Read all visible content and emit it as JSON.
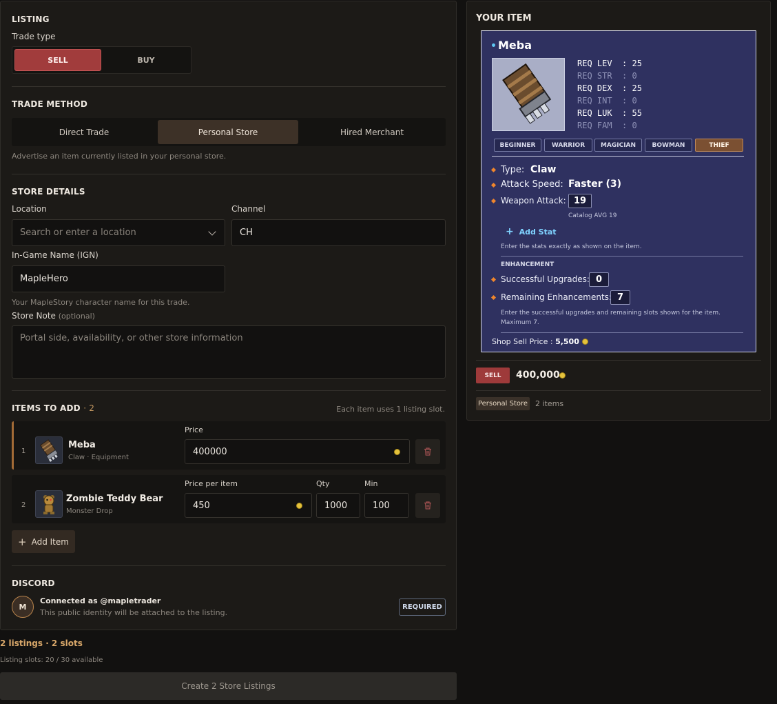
{
  "listing": {
    "section_title": "LISTING",
    "trade_type_label": "Trade type",
    "sell_label": "SELL",
    "buy_label": "BUY"
  },
  "trade_method": {
    "section_title": "TRADE METHOD",
    "options": [
      "Direct Trade",
      "Personal Store",
      "Hired Merchant"
    ],
    "active": "Personal Store",
    "hint": "Advertise an item currently listed in your personal store."
  },
  "store_details": {
    "section_title": "STORE DETAILS",
    "location_label": "Location",
    "location_placeholder": "Search or enter a location",
    "channel_label": "Channel",
    "channel_value": "CH",
    "ign_label": "In-Game Name (IGN)",
    "ign_value": "MapleHero",
    "ign_hint": "Your MapleStory character name for this trade.",
    "note_label": "Store Note",
    "note_optional": "(optional)",
    "note_placeholder": "Portal side, availability, or other store information"
  },
  "items_to_add": {
    "section_title": "ITEMS TO ADD",
    "count": "· 2",
    "slot_hint": "Each item uses 1 listing slot.",
    "items": [
      {
        "index": "1",
        "name": "Meba",
        "subtitle": "Claw · Equipment",
        "price_label": "Price",
        "price_value": "400000"
      },
      {
        "index": "2",
        "name": "Zombie Teddy Bear",
        "subtitle": "Monster Drop",
        "price_label": "Price per item",
        "price_value": "450",
        "qty_label": "Qty",
        "qty_value": "1000",
        "min_label": "Min",
        "min_value": "100"
      }
    ],
    "add_item_label": "Add Item"
  },
  "discord": {
    "section_title": "DISCORD",
    "avatar_letter": "M",
    "connected_text": "Connected as @mapletrader",
    "identity_hint": "This public identity will be attached to the listing.",
    "required_label": "REQUIRED"
  },
  "footer": {
    "summary": "2 listings · 2 slots",
    "slots_available": "Listing slots: 20 / 30 available",
    "create_button": "Create 2 Store Listings"
  },
  "your_item": {
    "section_title": "YOUR ITEM",
    "name": "Meba",
    "requirements": [
      {
        "text": "REQ LEV  : 25",
        "active": true
      },
      {
        "text": "REQ STR  : 0",
        "active": false
      },
      {
        "text": "REQ DEX  : 25",
        "active": true
      },
      {
        "text": "REQ INT  : 0",
        "active": false
      },
      {
        "text": "REQ LUK  : 55",
        "active": true
      },
      {
        "text": "REQ FAM  : 0",
        "active": false
      }
    ],
    "jobs": [
      "BEGINNER",
      "WARRIOR",
      "MAGICIAN",
      "BOWMAN",
      "THIEF"
    ],
    "active_job": "THIEF",
    "type_label": "Type:",
    "type_value": "Claw",
    "speed_label": "Attack Speed:",
    "speed_value": "Faster (3)",
    "weapon_attack_label": "Weapon Attack:",
    "weapon_attack_value": "19",
    "catalog_avg": "Catalog AVG 19",
    "add_stat_label": "Add Stat",
    "stats_hint": "Enter the stats exactly as shown on the item.",
    "enhancement_title": "ENHANCEMENT",
    "upgrades_label": "Successful Upgrades:",
    "upgrades_value": "0",
    "remaining_label": "Remaining Enhancements:",
    "remaining_value": "7",
    "enhancement_hint_1": "Enter the successful upgrades and remaining slots shown for the item.",
    "enhancement_hint_2": "Maximum 7.",
    "shop_price_label": "Shop Sell Price :",
    "shop_price_value": "5,500",
    "sell_tag": "SELL",
    "listing_price": "400,000",
    "store_tag": "Personal Store",
    "item_count": "2 items"
  },
  "colors": {
    "accent_sell": "#a13c3c",
    "accent_store": "#3d3127",
    "tooltip_bg": "#2f3160",
    "active_job": "#7b5032",
    "coin": "#e4c23c"
  }
}
